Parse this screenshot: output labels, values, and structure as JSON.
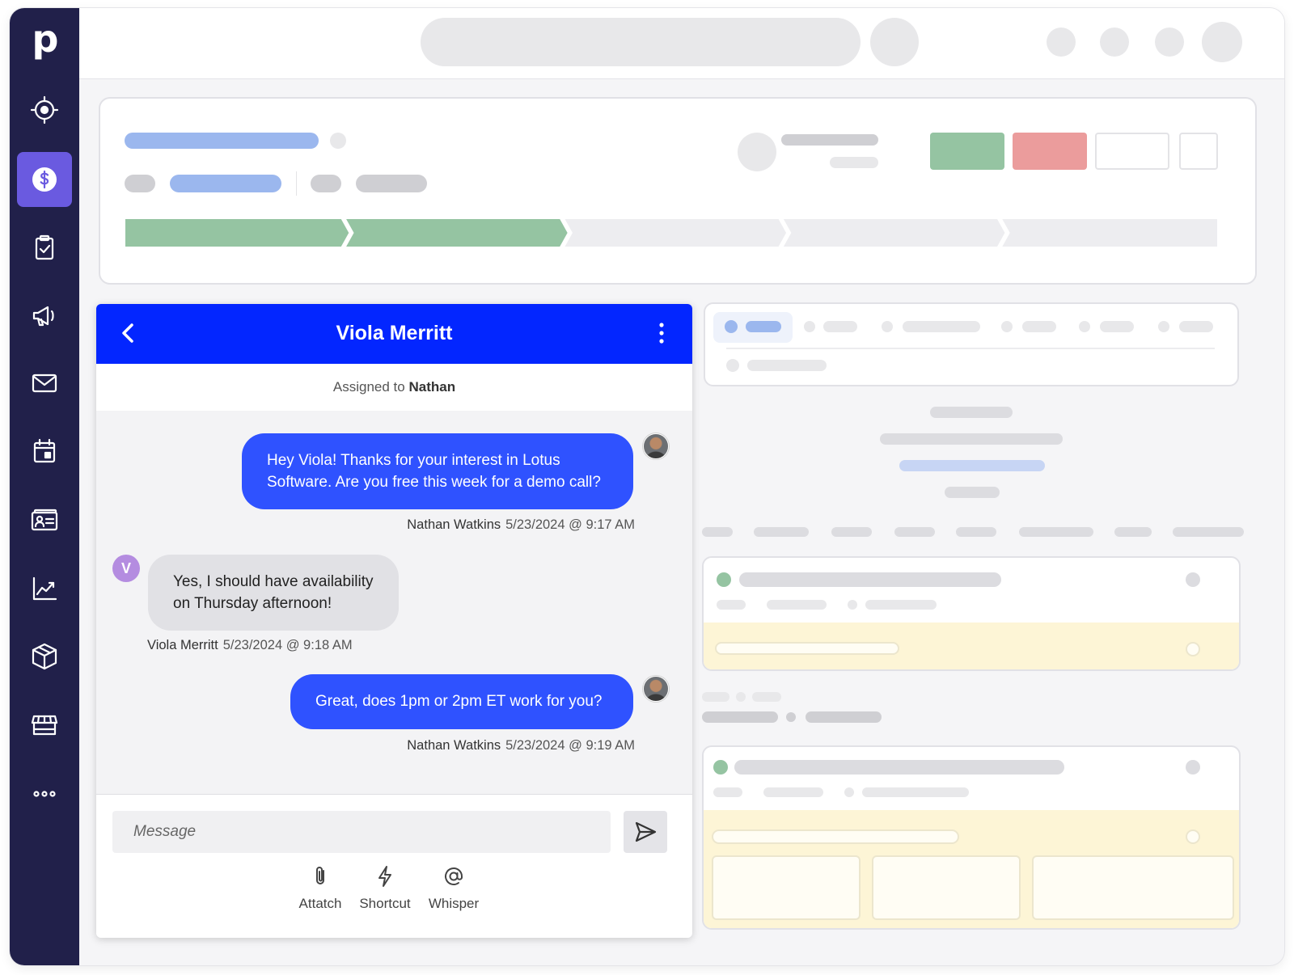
{
  "app": {
    "logo_letter": "p",
    "brand_color": "#21204a",
    "accent_color": "#6a5ae0"
  },
  "sidebar": {
    "items": [
      {
        "icon": "target-icon",
        "active": false
      },
      {
        "icon": "dollar-icon",
        "active": true
      },
      {
        "icon": "clipboard-check-icon",
        "active": false
      },
      {
        "icon": "megaphone-icon",
        "active": false
      },
      {
        "icon": "mail-icon",
        "active": false
      },
      {
        "icon": "calendar-icon",
        "active": false
      },
      {
        "icon": "contact-card-icon",
        "active": false
      },
      {
        "icon": "chart-icon",
        "active": false
      },
      {
        "icon": "box-icon",
        "active": false
      },
      {
        "icon": "store-icon",
        "active": false
      },
      {
        "icon": "more-icon",
        "active": false
      }
    ]
  },
  "deal": {
    "won_button_color": "#95c4a2",
    "lost_button_color": "#eb9c9c",
    "pipeline_stages_completed": 2,
    "pipeline_stages_total": 5,
    "stage_color": "#95c4a2"
  },
  "chat": {
    "header_title": "Viola Merritt",
    "header_color": "#0326ff",
    "assigned_prefix": "Assigned to",
    "assigned_name": "Nathan",
    "messages": [
      {
        "direction": "out",
        "text": "Hey Viola! Thanks for your interest in Lotus Software. Are you free this week for a demo call?",
        "line1": "Hey Viola! Thanks for your interest in Lotus",
        "line2": "Software. Are you free this week for a demo call?",
        "sender": "Nathan Watkins",
        "timestamp": "5/23/2024 @ 9:17 AM"
      },
      {
        "direction": "in",
        "line1": "Yes, I should have availability",
        "line2": "on Thursday afternoon!",
        "sender": "Viola Merritt",
        "timestamp": "5/23/2024 @ 9:18 AM",
        "avatar_letter": "V"
      },
      {
        "direction": "out",
        "line1": "Great, does 1pm or 2pm ET work for you?",
        "sender": "Nathan Watkins",
        "timestamp": "5/23/2024 @ 9:19 AM"
      }
    ],
    "composer": {
      "placeholder": "Message",
      "tools": [
        {
          "label": "Attatch",
          "icon": "paperclip-icon"
        },
        {
          "label": "Shortcut",
          "icon": "lightning-icon"
        },
        {
          "label": "Whisper",
          "icon": "at-sign-icon"
        }
      ]
    }
  }
}
